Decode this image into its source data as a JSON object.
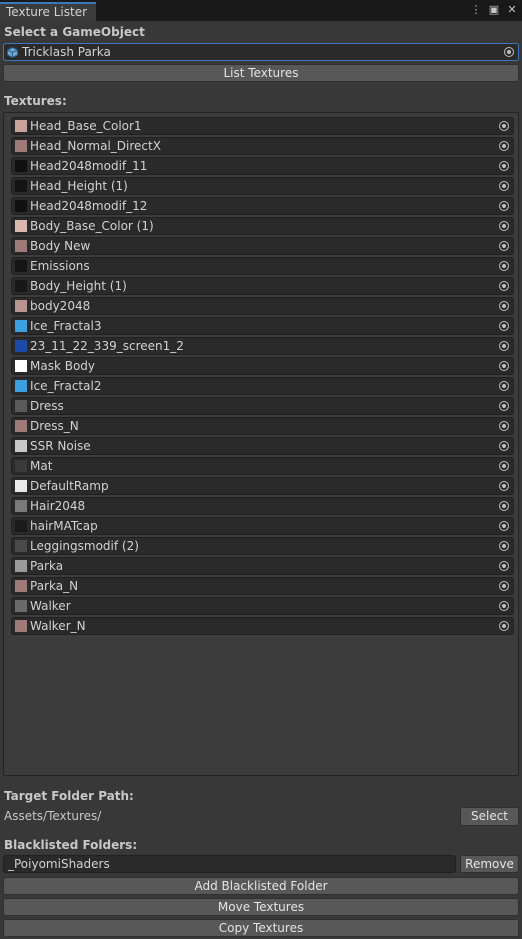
{
  "window": {
    "tab_title": "Texture Lister",
    "icons": [
      "more-vert-icon",
      "maximize-icon",
      "close-icon"
    ]
  },
  "select_object": {
    "label": "Select a GameObject",
    "value": "Tricklash Parka",
    "list_button": "List Textures"
  },
  "textures": {
    "label": "Textures:",
    "items": [
      {
        "name": "Head_Base_Color1",
        "thumb": "#c9a39b"
      },
      {
        "name": "Head_Normal_DirectX",
        "thumb": "#9e7a78"
      },
      {
        "name": "Head2048modif_11",
        "thumb": "#101010"
      },
      {
        "name": "Head_Height (1)",
        "thumb": "#141414"
      },
      {
        "name": "Head2048modif_12",
        "thumb": "#111111"
      },
      {
        "name": "Body_Base_Color (1)",
        "thumb": "#d9b8ae"
      },
      {
        "name": "Body New",
        "thumb": "#9e7a78"
      },
      {
        "name": "Emissions",
        "thumb": "#151515"
      },
      {
        "name": "Body_Height (1)",
        "thumb": "#181818"
      },
      {
        "name": "body2048",
        "thumb": "#b89590"
      },
      {
        "name": "Ice_Fractal3",
        "thumb": "#3aa0e0"
      },
      {
        "name": "23_11_22_339_screen1_2",
        "thumb": "#1b4aa8"
      },
      {
        "name": "Mask Body",
        "thumb": "#ffffff"
      },
      {
        "name": "Ice_Fractal2",
        "thumb": "#3aa0e0"
      },
      {
        "name": "Dress",
        "thumb": "#5a5a5a"
      },
      {
        "name": "Dress_N",
        "thumb": "#9e7a78"
      },
      {
        "name": "SSR Noise",
        "thumb": "#c8c8c8"
      },
      {
        "name": "Mat",
        "thumb": "#3a3a3a"
      },
      {
        "name": "DefaultRamp",
        "thumb": "#e8e8e8"
      },
      {
        "name": "Hair2048",
        "thumb": "#7a7a7a"
      },
      {
        "name": "hairMATcap",
        "thumb": "#1a1a1a"
      },
      {
        "name": "Leggingsmodif (2)",
        "thumb": "#4a4a4a"
      },
      {
        "name": "Parka",
        "thumb": "#9a9a9a"
      },
      {
        "name": "Parka_N",
        "thumb": "#9e7a78"
      },
      {
        "name": "Walker",
        "thumb": "#6a6a6a"
      },
      {
        "name": "Walker_N",
        "thumb": "#9e7a78"
      }
    ]
  },
  "target_folder": {
    "label": "Target Folder Path:",
    "path": "Assets/Textures/",
    "select_button": "Select"
  },
  "blacklist": {
    "label": "Blacklisted Folders:",
    "folders": [
      "_PoiyomiShaders"
    ],
    "remove_button": "Remove",
    "add_button": "Add Blacklisted Folder"
  },
  "actions": {
    "move_button": "Move Textures",
    "copy_button": "Copy Textures"
  },
  "colors": {
    "accent": "#3a79bb",
    "background": "#383838",
    "field": "#2a2a2a",
    "button": "#585858"
  }
}
